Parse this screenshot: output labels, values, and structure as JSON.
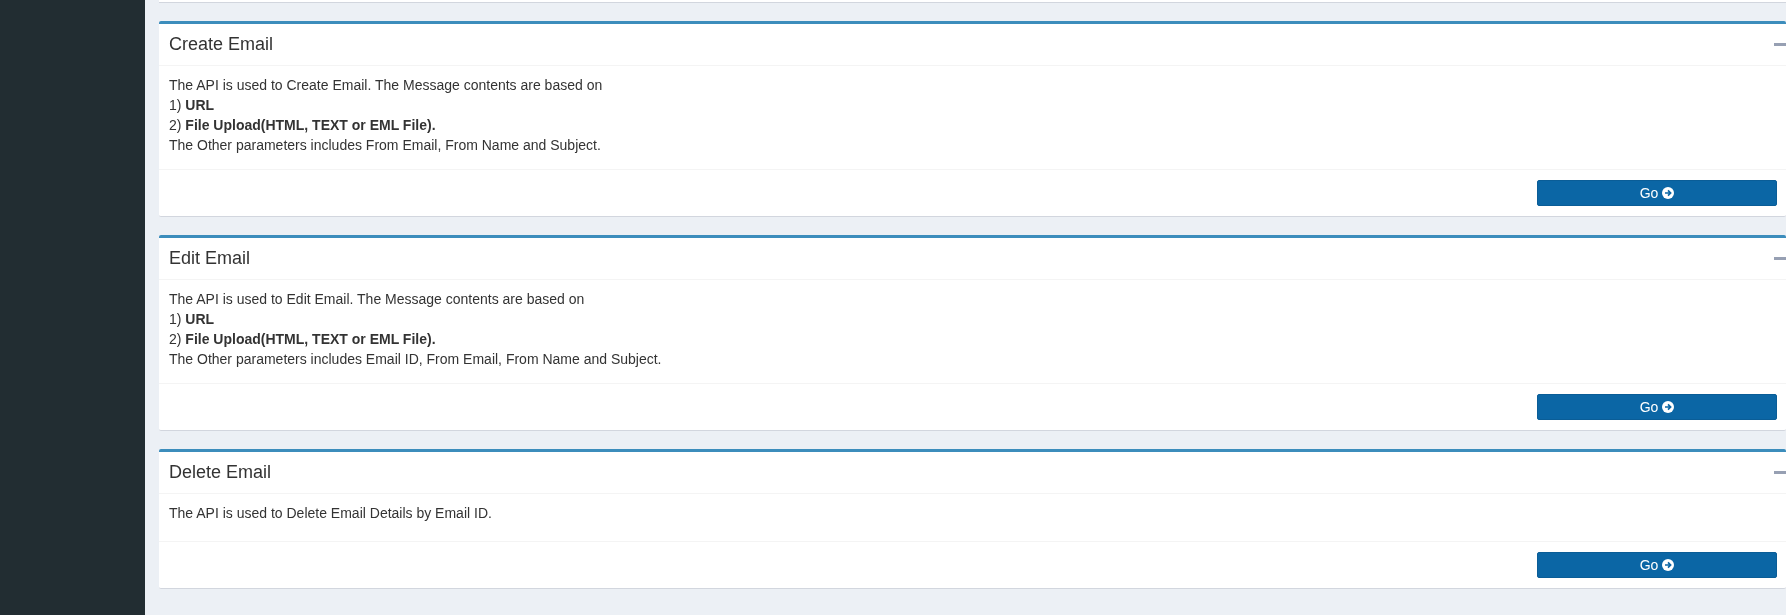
{
  "panels": [
    {
      "title": "Create Email",
      "collapsible": true,
      "lines": [
        "The API is used to Create Email. The Message contents are based on",
        "1) **URL**",
        "2) **File Upload(HTML, TEXT or EML File).**",
        "The Other parameters includes From Email, From Name and Subject."
      ],
      "button": "Go"
    },
    {
      "title": "Edit Email",
      "collapsible": true,
      "lines": [
        "The API is used to Edit Email. The Message contents are based on",
        "1) **URL**",
        "2) **File Upload(HTML, TEXT or EML File).**",
        "The Other parameters includes Email ID, From Email, From Name and Subject."
      ],
      "button": "Go"
    },
    {
      "title": "Delete Email",
      "collapsible": true,
      "lines": [
        "The API is used to Delete Email Details by Email ID."
      ],
      "button": "Go"
    }
  ]
}
